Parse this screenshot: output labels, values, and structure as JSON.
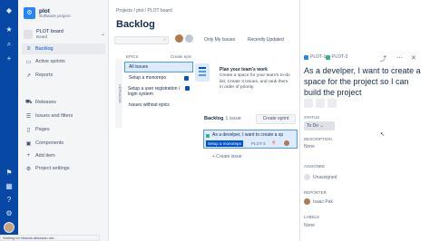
{
  "rail": {
    "icons": [
      "jira-logo-icon",
      "star-icon",
      "search-icon",
      "plus-icon",
      "notification-icon",
      "app-switcher-icon",
      "help-icon",
      "settings-icon"
    ]
  },
  "sidebar": {
    "project_name": "plot",
    "project_type": "Software project",
    "board_name": "PLOT board",
    "board_type": "Board",
    "items": [
      {
        "label": "Backlog",
        "icon": "backlog-icon",
        "active": true
      },
      {
        "label": "Active sprints",
        "icon": "sprint-icon",
        "active": false
      },
      {
        "label": "Reports",
        "icon": "reports-icon",
        "active": false
      },
      {
        "label": "Releases",
        "icon": "releases-icon",
        "active": false
      },
      {
        "label": "Issues and filters",
        "icon": "issues-icon",
        "active": false
      },
      {
        "label": "Pages",
        "icon": "pages-icon",
        "active": false
      },
      {
        "label": "Components",
        "icon": "components-icon",
        "active": false
      },
      {
        "label": "Add item",
        "icon": "add-icon",
        "active": false
      },
      {
        "label": "Project settings",
        "icon": "settings-icon",
        "active": false
      }
    ]
  },
  "main": {
    "breadcrumb": "Projects  /  plot  /  PLOT board",
    "title": "Backlog",
    "quick_filters": [
      "Only My Issues",
      "Recently Updated"
    ],
    "versions_label": "VERSIONS",
    "epics_header": "EPICS",
    "create_epic": "Create epic",
    "epics": [
      {
        "label": "All issues",
        "selected": true,
        "checked": false
      },
      {
        "label": "Setup a monorepo",
        "selected": false,
        "checked": true
      },
      {
        "label": "Setup a user registration / login system",
        "selected": false,
        "checked": true
      },
      {
        "label": "Issues without epics",
        "selected": false,
        "checked": false
      }
    ],
    "plan_title": "Plan your team's work",
    "plan_text": "Create a space for your team's to-do list. Create 3 issues, and rank them in order of priority.",
    "backlog_label": "Backlog",
    "backlog_count": "1 issue",
    "create_sprint": "Create sprint",
    "issue": {
      "summary": "As a develper, I want to create a sp",
      "epic": "Setup a monorepo",
      "key": "PLOT-3"
    },
    "create_issue": "+  Create issue"
  },
  "detail": {
    "parent_key": "PLOT-1",
    "key": "PLOT-3",
    "title": "As a develper, I want to create a space for the project so I can build the project",
    "status_label": "STATUS",
    "status_value": "To Do",
    "description_label": "DESCRIPTION",
    "description_value": "None",
    "assignee_label": "ASSIGNEE",
    "assignee_value": "Unassigned",
    "reporter_label": "REPORTER",
    "reporter_value": "Isaac Pak",
    "labels_label": "LABELS",
    "labels_value": "None"
  },
  "statusbar": {
    "text": "Waiting for hitstats.atlassian.net..."
  }
}
